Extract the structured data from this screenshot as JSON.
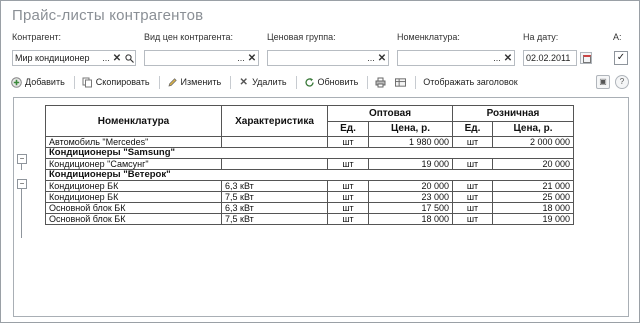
{
  "title": "Прайс-листы контрагентов",
  "filters": {
    "contractor": {
      "label": "Контрагент:",
      "value": "Мир кондиционер"
    },
    "price_type": {
      "label": "Вид цен контрагента:",
      "value": ""
    },
    "price_group": {
      "label": "Ценовая группа:",
      "value": ""
    },
    "nomenclature": {
      "label": "Номенклатура:",
      "value": ""
    },
    "date": {
      "label": "На дату:",
      "value": "02.02.2011"
    },
    "actual": {
      "label": "А:",
      "checked": true
    }
  },
  "toolbar": {
    "add": "Добавить",
    "copy": "Скопировать",
    "edit": "Изменить",
    "delete": "Удалить",
    "refresh": "Обновить",
    "show_header": "Отображать заголовок"
  },
  "table": {
    "headers": {
      "nomenclature": "Номенклатура",
      "characteristic": "Характеристика",
      "wholesale": "Оптовая",
      "retail": "Розничная",
      "unit": "Ед.",
      "price": "Цена, р."
    },
    "rows": [
      {
        "type": "item",
        "name": "Автомобиль \"Mercedes\"",
        "char": "",
        "w_unit": "шт",
        "w_price": "1 980 000",
        "r_unit": "шт",
        "r_price": "2 000 000"
      },
      {
        "type": "group",
        "name": "Кондиционеры \"Samsung\""
      },
      {
        "type": "item",
        "name": "Кондиционер \"Самсунг\"",
        "char": "",
        "w_unit": "шт",
        "w_price": "19 000",
        "r_unit": "шт",
        "r_price": "20 000"
      },
      {
        "type": "group",
        "name": "Кондиционеры \"Ветерок\""
      },
      {
        "type": "item",
        "name": "Кондиционер БК",
        "char": "6,3 кВт",
        "w_unit": "шт",
        "w_price": "20 000",
        "r_unit": "шт",
        "r_price": "21 000"
      },
      {
        "type": "item",
        "name": "Кондиционер БК",
        "char": "7,5 кВт",
        "w_unit": "шт",
        "w_price": "23 000",
        "r_unit": "шт",
        "r_price": "25 000"
      },
      {
        "type": "item",
        "name": "Основной блок БК",
        "char": "6,3 кВт",
        "w_unit": "шт",
        "w_price": "17 500",
        "r_unit": "шт",
        "r_price": "18 000"
      },
      {
        "type": "item",
        "name": "Основной блок БК",
        "char": "7,5 кВт",
        "w_unit": "шт",
        "w_price": "18 000",
        "r_unit": "шт",
        "r_price": "19 000"
      }
    ]
  }
}
